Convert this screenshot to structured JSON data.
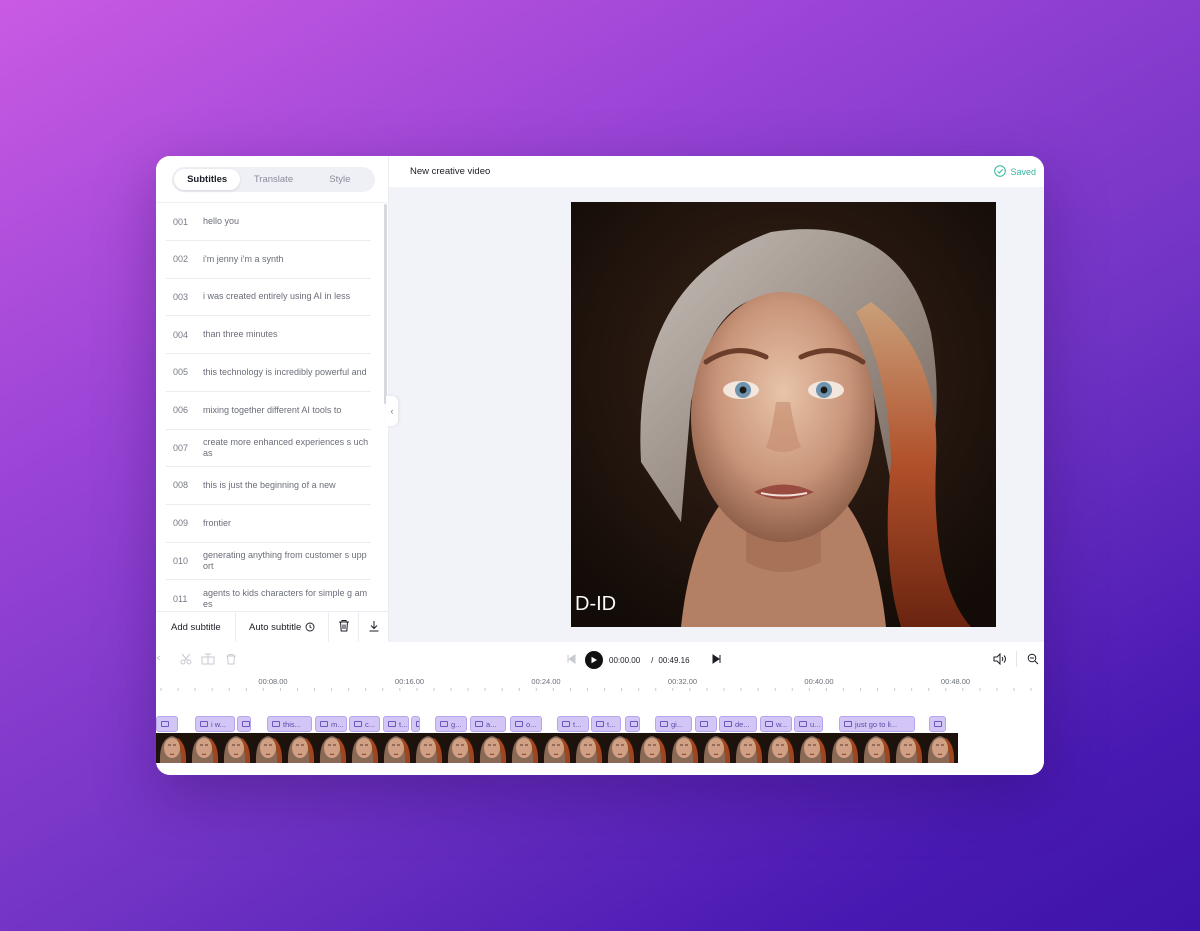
{
  "sidebar": {
    "tabs": [
      {
        "label": "Subtitles",
        "active": true
      },
      {
        "label": "Translate",
        "active": false
      },
      {
        "label": "Style",
        "active": false
      }
    ],
    "subtitles": [
      {
        "num": "001",
        "text": "hello you"
      },
      {
        "num": "002",
        "text": "i'm jenny i'm a synth"
      },
      {
        "num": "003",
        "text": "i was created entirely using AI in less"
      },
      {
        "num": "004",
        "text": "than three minutes"
      },
      {
        "num": "005",
        "text": "this technology is incredibly powerful and"
      },
      {
        "num": "006",
        "text": "mixing together different AI tools to"
      },
      {
        "num": "007",
        "text": "create more enhanced experiences s uch as"
      },
      {
        "num": "008",
        "text": "this is just the beginning of a new"
      },
      {
        "num": "009",
        "text": "frontier"
      },
      {
        "num": "010",
        "text": "generating anything from customer s upport"
      },
      {
        "num": "011",
        "text": "agents to kids characters for simple g ames"
      }
    ],
    "footer": {
      "add_label": "Add subtitle",
      "auto_label": "Auto subtitle"
    }
  },
  "header": {
    "title": "New creative video",
    "status": "Saved"
  },
  "video": {
    "watermark": "D-ID"
  },
  "player": {
    "current_time": "00:00.00",
    "separator": "/",
    "total_time": "00:49.16"
  },
  "timeline": {
    "ticks": [
      "00:08.00",
      "00:16.00",
      "00:24.00",
      "00:32.00",
      "00:40.00",
      "00:48.00"
    ],
    "clips": [
      "",
      "i w...",
      "",
      "this...",
      "m...",
      "c...",
      "t...",
      "",
      "g...",
      "a...",
      "o...",
      "t...",
      "t...",
      "",
      "gi...",
      "",
      "de...",
      "w...",
      "u...",
      "just go to li...",
      ""
    ],
    "thumbnail_count": 25
  },
  "colors": {
    "accent": "#5c4aa8",
    "saved": "#35b6a1",
    "clip_fill": "#d3c6f7"
  }
}
